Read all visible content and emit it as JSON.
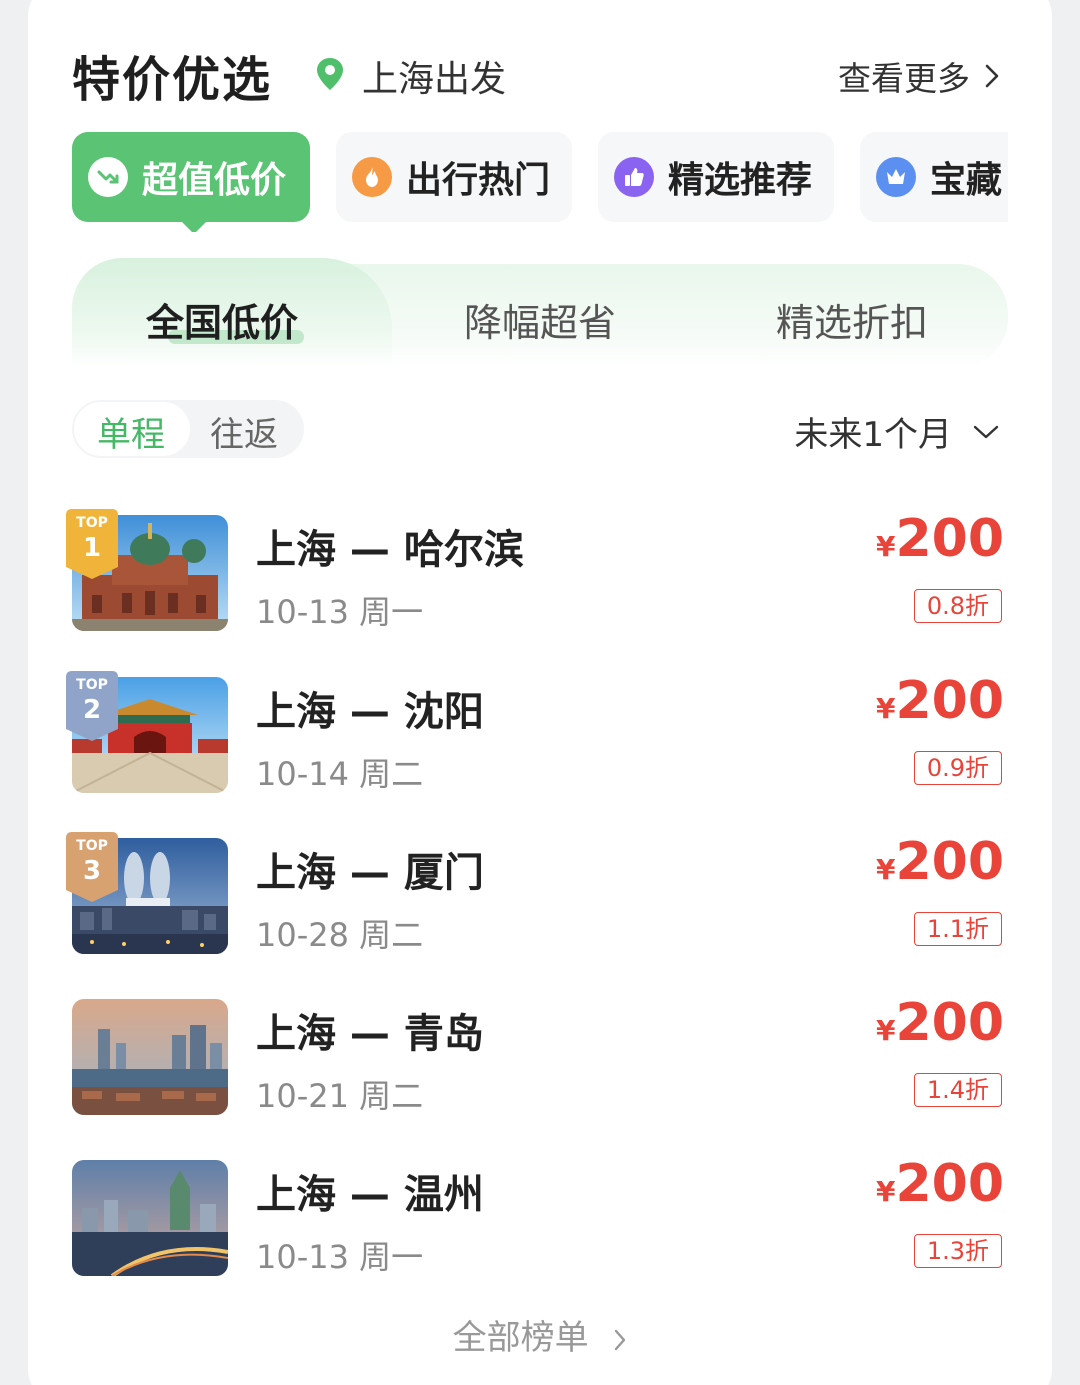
{
  "header": {
    "title": "特价优选",
    "location": "上海出发",
    "more": "查看更多"
  },
  "categories": [
    {
      "label": "超值低价",
      "icon": "trend-down-icon",
      "active": true
    },
    {
      "label": "出行热门",
      "icon": "flame-icon",
      "active": false
    },
    {
      "label": "精选推荐",
      "icon": "thumbs-up-icon",
      "active": false
    },
    {
      "label": "宝藏",
      "icon": "crown-icon",
      "active": false
    }
  ],
  "subtabs": [
    "全国低价",
    "降幅超省",
    "精选折扣"
  ],
  "trip_toggle": {
    "oneway": "单程",
    "roundtrip": "往返",
    "selected": "单程"
  },
  "period": "未来1个月",
  "rank_tag": "TOP",
  "flights": [
    {
      "route": "上海 — 哈尔滨",
      "date": "10-13 周一",
      "currency": "¥",
      "price": "200",
      "discount": "0.8折",
      "rank": "1",
      "image": "harbin-cathedral-image"
    },
    {
      "route": "上海 — 沈阳",
      "date": "10-14 周二",
      "currency": "¥",
      "price": "200",
      "discount": "0.9折",
      "rank": "2",
      "image": "shenyang-palace-image"
    },
    {
      "route": "上海 — 厦门",
      "date": "10-28 周二",
      "currency": "¥",
      "price": "200",
      "discount": "1.1折",
      "rank": "3",
      "image": "xiamen-towers-image"
    },
    {
      "route": "上海 — 青岛",
      "date": "10-21 周二",
      "currency": "¥",
      "price": "200",
      "discount": "1.4折",
      "rank": "",
      "image": "qingdao-skyline-image"
    },
    {
      "route": "上海 — 温州",
      "date": "10-13 周一",
      "currency": "¥",
      "price": "200",
      "discount": "1.3折",
      "rank": "",
      "image": "wenzhou-skyline-image"
    }
  ],
  "footer": {
    "all": "全部榜单"
  },
  "colors": {
    "accent": "#5ac374",
    "price": "#e8443a",
    "gold": "#f0b43a",
    "silver": "#8fa4c8",
    "bronze": "#d8a270"
  }
}
